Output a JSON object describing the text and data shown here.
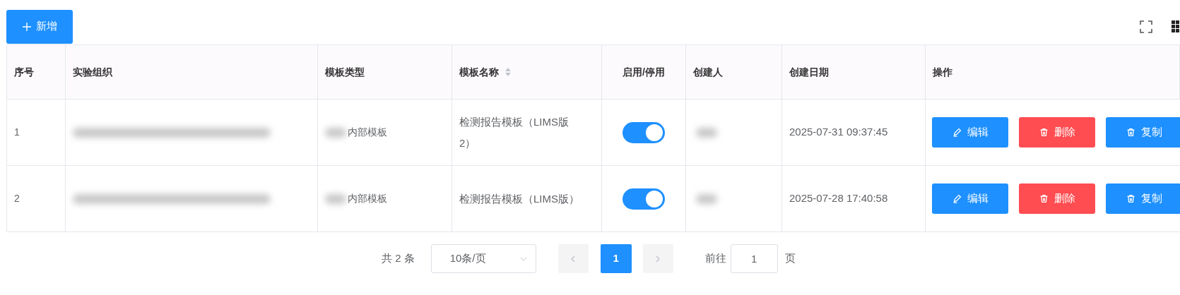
{
  "toolbar": {
    "add_button": "新增"
  },
  "table": {
    "columns": [
      {
        "label": "序号",
        "sortable": false
      },
      {
        "label": "实验组织",
        "sortable": false
      },
      {
        "label": "模板类型",
        "sortable": false
      },
      {
        "label": "模板名称",
        "sortable": true
      },
      {
        "label": "启用/停用",
        "sortable": false
      },
      {
        "label": "创建人",
        "sortable": false
      },
      {
        "label": "创建日期",
        "sortable": false
      },
      {
        "label": "操作",
        "sortable": false
      }
    ],
    "rows": [
      {
        "index": "1",
        "type": "内部模板",
        "name": "检测报告模板（LIMS版2）",
        "enabled": true,
        "created": "2025-07-31 09:37:45",
        "actions": [
          {
            "kind": "edit",
            "label": "编辑"
          },
          {
            "kind": "delete",
            "label": "删除"
          },
          {
            "kind": "copy",
            "label": "复制"
          }
        ]
      },
      {
        "index": "2",
        "type": "内部模板",
        "name": "检测报告模板（LIMS版）",
        "enabled": true,
        "created": "2025-07-28 17:40:58",
        "actions": [
          {
            "kind": "edit",
            "label": "编辑"
          },
          {
            "kind": "delete",
            "label": "删除"
          },
          {
            "kind": "copy",
            "label": "复制"
          }
        ]
      }
    ]
  },
  "pagination": {
    "total": "共 2 条",
    "page_size": "10条/页",
    "pages": [
      {
        "label": "1",
        "selected": true
      }
    ],
    "goto_label": "前往",
    "goto_value": "1",
    "goto_suffix": "页"
  }
}
